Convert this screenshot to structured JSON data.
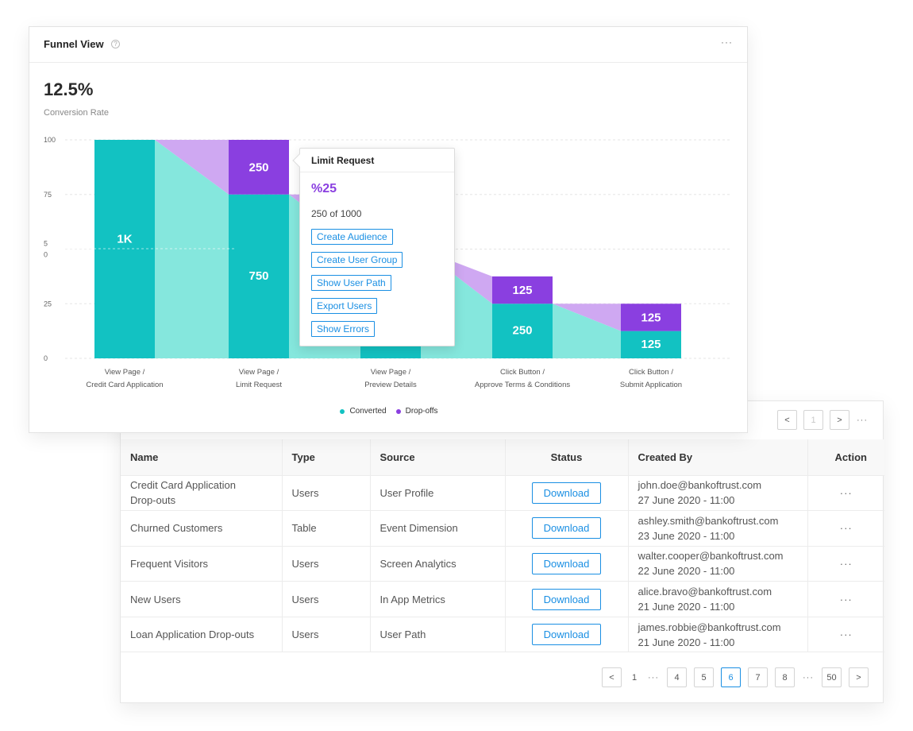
{
  "funnel": {
    "title": "Funnel View",
    "help_icon": "?",
    "more": "···",
    "rate": "12.5%",
    "rate_label": "Conversion Rate",
    "legend": [
      {
        "label": "Converted",
        "color": "#12c2c2"
      },
      {
        "label": "Drop-offs",
        "color": "#8a3fe0"
      }
    ]
  },
  "tooltip": {
    "title": "Limit Request",
    "percent": "%25",
    "count": "250 of 1000",
    "actions": [
      "Create Audience",
      "Create User Group",
      "Show User Path",
      "Export Users",
      "Show Errors"
    ]
  },
  "chart_data": {
    "type": "bar",
    "subtype": "funnel",
    "y_ticks": [
      "100",
      "75",
      "5\n0",
      "25",
      "0"
    ],
    "ylim": [
      0,
      100
    ],
    "grid": true,
    "legend_placement": "bottom-center",
    "colors": {
      "converted": "#12c2c2",
      "converted_area": "#85e7dd",
      "dropoff": "#8a3fe0",
      "dropoff_area": "#cfa8f2"
    },
    "categories": [
      "View Page /\nCredit Card Application",
      "View Page /\nLimit Request",
      "View Page /\nPreview Details",
      "Click Button /\nApprove Terms & Conditions",
      "Click Button /\nSubmit Application"
    ],
    "series": [
      {
        "name": "Converted",
        "values": [
          100,
          75,
          50,
          25,
          12.5
        ],
        "labels": [
          "1K",
          "750",
          "",
          "250",
          "125"
        ]
      },
      {
        "name": "Drop-offs",
        "values": [
          0,
          25,
          25,
          12.5,
          12.5
        ],
        "labels": [
          "",
          "250",
          "",
          "125",
          "125"
        ]
      }
    ]
  },
  "table": {
    "pager_top": {
      "prev": "<",
      "page": "1",
      "next": ">",
      "more": "···"
    },
    "columns": [
      "Name",
      "Type",
      "Source",
      "Status",
      "Created By",
      "Action"
    ],
    "rows": [
      {
        "name": "Credit Card Application\nDrop-outs",
        "type": "Users",
        "source": "User Profile",
        "status": "Download",
        "email": "john.doe@bankoftrust.com",
        "date": "27 June 2020 - 11:00",
        "action": "···"
      },
      {
        "name": "Churned Customers",
        "type": "Table",
        "source": "Event Dimension",
        "status": "Download",
        "email": "ashley.smith@bankoftrust.com",
        "date": "23 June 2020 - 11:00",
        "action": "···"
      },
      {
        "name": "Frequent Visitors",
        "type": "Users",
        "source": "Screen Analytics",
        "status": "Download",
        "email": "walter.cooper@bankoftrust.com",
        "date": "22 June 2020 - 11:00",
        "action": "···"
      },
      {
        "name": "New Users",
        "type": "Users",
        "source": "In App Metrics",
        "status": "Download",
        "email": "alice.bravo@bankoftrust.com",
        "date": "21 June 2020 - 11:00",
        "action": "···"
      },
      {
        "name": "Loan Application Drop-outs",
        "type": "Users",
        "source": "User Path",
        "status": "Download",
        "email": "james.robbie@bankoftrust.com",
        "date": "21 June 2020 - 11:00",
        "action": "···"
      }
    ],
    "pager_bottom": {
      "prev": "<",
      "pages": [
        "1",
        "4",
        "5",
        "6",
        "7",
        "8",
        "50"
      ],
      "active": "6",
      "dots": "···",
      "next": ">"
    }
  }
}
